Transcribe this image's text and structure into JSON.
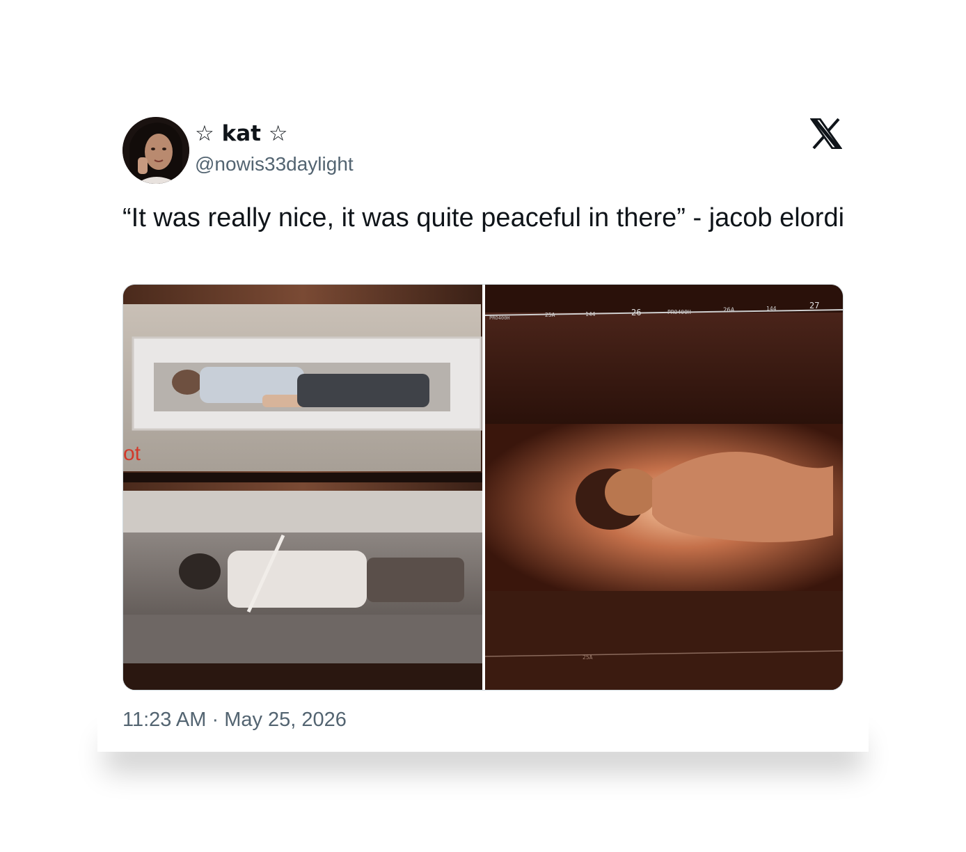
{
  "tweet": {
    "display_name": "☆ kat ☆",
    "handle": "@nowis33daylight",
    "text": "“It was really nice, it was quite peaceful in there” - jacob elordi",
    "time": "11:23 AM",
    "separator": "·",
    "date": "May 25, 2026"
  },
  "media": {
    "left_overlay_text": "ot",
    "film_strip_labels": [
      "PRO400H",
      "25A",
      "144",
      "26",
      "PRO400H",
      "26A",
      "144",
      "27"
    ],
    "bottom_frame_label": "25A"
  },
  "brand": {
    "logo_icon": "x-logo-icon",
    "colors": {
      "text": "#0f1419",
      "secondary": "#536471",
      "border": "#cfd9de"
    }
  }
}
